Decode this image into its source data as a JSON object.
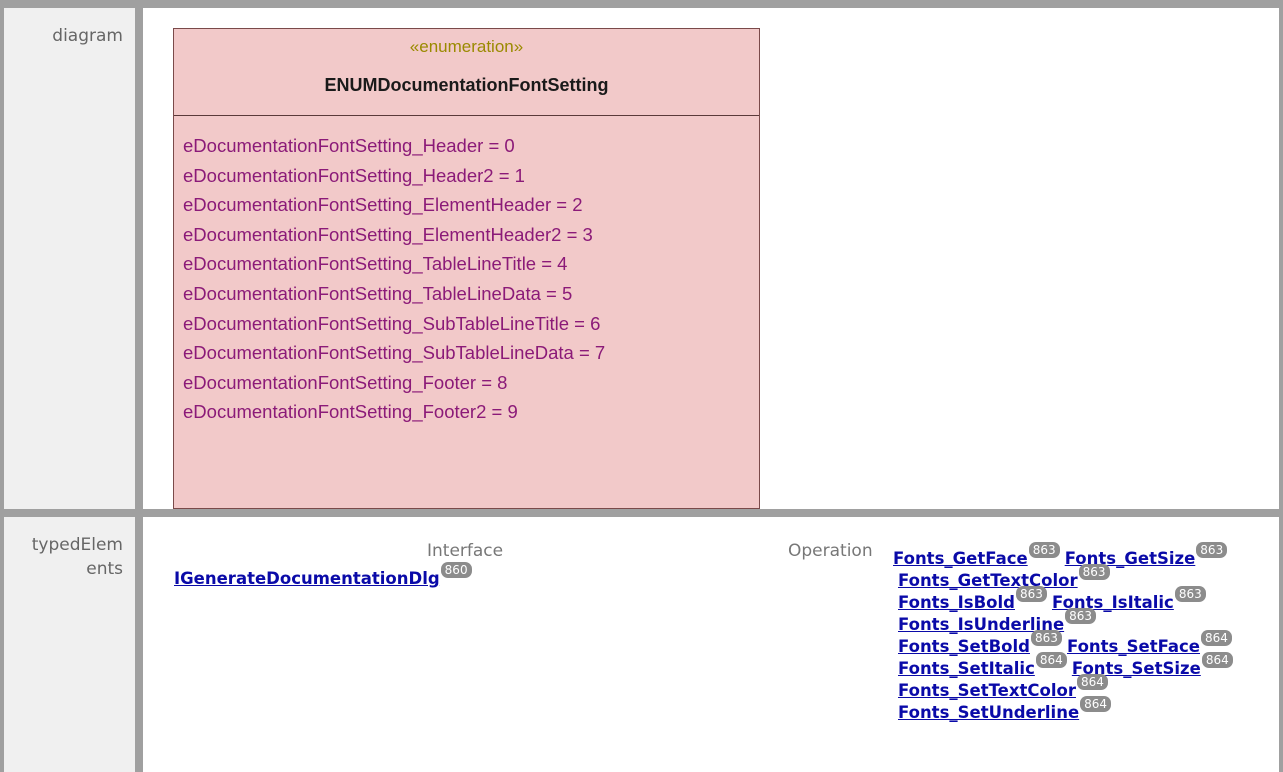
{
  "rows": {
    "diagram_label": "diagram",
    "typed_label_1": "typedElem",
    "typed_label_2": "ents"
  },
  "uml": {
    "stereotype": "«enumeration»",
    "name": "ENUMDocumentationFontSetting",
    "literals": [
      "eDocumentationFontSetting_Header = 0",
      "eDocumentationFontSetting_Header2 = 1",
      "eDocumentationFontSetting_ElementHeader = 2",
      "eDocumentationFontSetting_ElementHeader2 = 3",
      "eDocumentationFontSetting_TableLineTitle = 4",
      "eDocumentationFontSetting_TableLineData = 5",
      "eDocumentationFontSetting_SubTableLineTitle = 6",
      "eDocumentationFontSetting_SubTableLineData = 7",
      "eDocumentationFontSetting_Footer = 8",
      "eDocumentationFontSetting_Footer2 = 9"
    ]
  },
  "typed": {
    "interface_header": "Interface",
    "operation_header": "Operation",
    "interface": {
      "label": "IGenerateDocumentationDlg",
      "page": "860"
    },
    "ops": {
      "get_face": {
        "label": "Fonts_GetFace",
        "page": "863"
      },
      "get_size": {
        "label": "Fonts_GetSize",
        "page": "863"
      },
      "get_text_color": {
        "label": "Fonts_GetTextColor",
        "page": "863"
      },
      "is_bold": {
        "label": "Fonts_IsBold",
        "page": "863"
      },
      "is_italic": {
        "label": "Fonts_IsItalic",
        "page": "863"
      },
      "is_underline": {
        "label": "Fonts_IsUnderline",
        "page": "863"
      },
      "set_bold": {
        "label": "Fonts_SetBold",
        "page": "863"
      },
      "set_face": {
        "label": "Fonts_SetFace",
        "page": "864"
      },
      "set_italic": {
        "label": "Fonts_SetItalic",
        "page": "864"
      },
      "set_size": {
        "label": "Fonts_SetSize",
        "page": "864"
      },
      "set_text_color": {
        "label": "Fonts_SetTextColor",
        "page": "864"
      },
      "set_underline": {
        "label": "Fonts_SetUnderline",
        "page": "864"
      }
    }
  }
}
